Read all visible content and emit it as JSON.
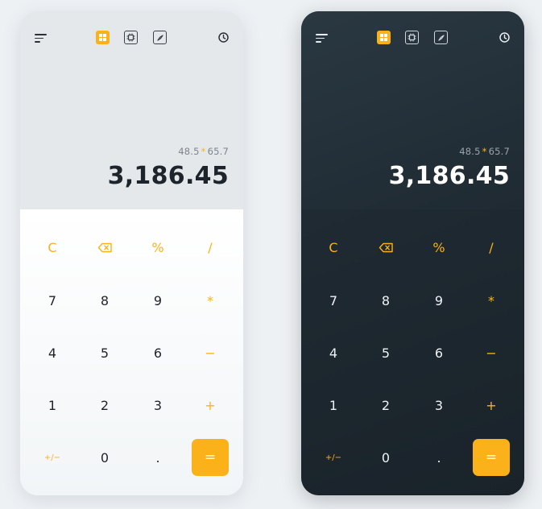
{
  "screens": [
    {
      "theme": "light",
      "expression": {
        "left": "48.5",
        "operator": "*",
        "right": "65.7"
      },
      "result": "3,186.45",
      "keys": {
        "clear": "C",
        "percent": "%",
        "divide": "/",
        "seven": "7",
        "eight": "8",
        "nine": "9",
        "multiply": "*",
        "four": "4",
        "five": "5",
        "six": "6",
        "minus": "−",
        "one": "1",
        "two": "2",
        "three": "3",
        "plus": "+",
        "negate": "+/−",
        "zero": "0",
        "decimal": ".",
        "equals": "="
      }
    },
    {
      "theme": "dark",
      "expression": {
        "left": "48.5",
        "operator": "*",
        "right": "65.7"
      },
      "result": "3,186.45",
      "keys": {
        "clear": "C",
        "percent": "%",
        "divide": "/",
        "seven": "7",
        "eight": "8",
        "nine": "9",
        "multiply": "*",
        "four": "4",
        "five": "5",
        "six": "6",
        "minus": "−",
        "one": "1",
        "two": "2",
        "three": "3",
        "plus": "+",
        "negate": "+/−",
        "zero": "0",
        "decimal": ".",
        "equals": "="
      }
    }
  ],
  "icons": {
    "menu": "menu-icon",
    "standard_mode": "grid-icon",
    "scientific_mode": "chip-icon",
    "converter_mode": "compass-icon",
    "history": "clock-icon",
    "backspace": "backspace-icon"
  },
  "colors": {
    "accent": "#fbb21a",
    "light_bg": "#f6f8f9",
    "dark_bg": "#1f2a32"
  }
}
